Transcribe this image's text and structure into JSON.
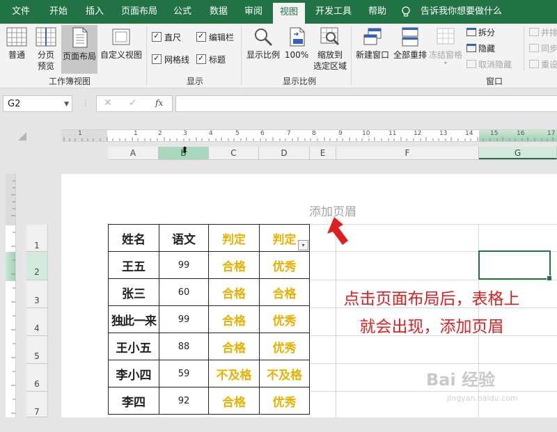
{
  "tabs": [
    {
      "label": "文件"
    },
    {
      "label": "开始"
    },
    {
      "label": "插入"
    },
    {
      "label": "页面布局"
    },
    {
      "label": "公式"
    },
    {
      "label": "数据"
    },
    {
      "label": "审阅"
    },
    {
      "label": "视图",
      "active": true
    },
    {
      "label": "开发工具"
    },
    {
      "label": "帮助"
    },
    {
      "label": "告诉我你想要做什么"
    }
  ],
  "ribbon": {
    "views": {
      "normal": "普通",
      "page_break_l1": "分页",
      "page_break_l2": "预览",
      "page_layout": "页面布局",
      "custom_views": "自定义视图",
      "group_label": "工作簿视图"
    },
    "show": {
      "ruler": "直尺",
      "formula_bar": "编辑栏",
      "gridlines": "网格线",
      "headings": "标题",
      "group_label": "显示"
    },
    "zoom": {
      "zoom": "显示比例",
      "hundred": "100%",
      "to_sel_l1": "缩放到",
      "to_sel_l2": "选定区域",
      "group_label": "显示比例"
    },
    "window": {
      "new_window": "新建窗口",
      "arrange_all": "全部重排",
      "freeze": "冻结窗格",
      "split": "拆分",
      "hide": "隐藏",
      "unhide": "取消隐藏",
      "side_by_side": "并排",
      "sync_scroll": "同步",
      "reset": "重设",
      "group_label": "窗口"
    }
  },
  "formula_bar": {
    "name_box": "G2",
    "cancel": "✕",
    "enter": "✓",
    "fx": "fx",
    "value": ""
  },
  "ruler_numbers": [
    "1",
    "1",
    "2",
    "3",
    "4",
    "5",
    "6",
    "7",
    "8",
    "9",
    "10",
    "11",
    "12",
    "13",
    "14",
    "15",
    "16",
    "17"
  ],
  "columns": [
    "A",
    "B",
    "C",
    "D",
    "E",
    "F",
    "G"
  ],
  "rows": [
    "1",
    "2",
    "3",
    "4",
    "5",
    "6",
    "7"
  ],
  "page": {
    "header_hint": "添加页眉"
  },
  "table": {
    "headers": [
      "姓名",
      "语文",
      "判定",
      "判定"
    ],
    "rows": [
      [
        "王五",
        "99",
        "合格",
        "优秀"
      ],
      [
        "张三",
        "60",
        "合格",
        "合格"
      ],
      [
        "独此一来",
        "99",
        "合格",
        "优秀"
      ],
      [
        "王小五",
        "88",
        "合格",
        "优秀"
      ],
      [
        "李小四",
        "59",
        "不及格",
        "不及格"
      ],
      [
        "李四",
        "92",
        "合格",
        "优秀"
      ]
    ]
  },
  "annotation": "点击页面布局后，表格上就会出现，添加页眉",
  "watermark": {
    "main": "Bai 经验",
    "sub": "jingyan.baidu.com"
  },
  "colors": {
    "excel_green": "#217346",
    "grade_gold": "#ecb100",
    "annotation_red": "#e02020"
  }
}
